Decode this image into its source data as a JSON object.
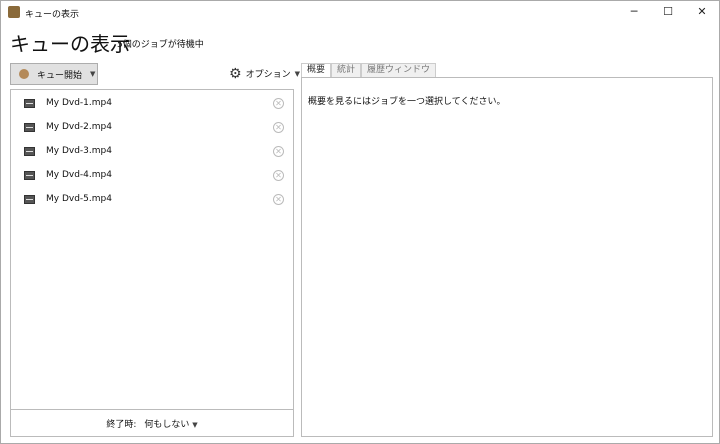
{
  "window": {
    "title": "キューの表示",
    "controls": [
      "─",
      "☐",
      "✕"
    ]
  },
  "header": {
    "title": "キューの表示",
    "subtitle": "5個のジョブが待機中"
  },
  "toolbar": {
    "start_label": "キュー開始",
    "options_label": "オプション"
  },
  "queue": {
    "items": [
      {
        "name": "My Dvd-1.mp4"
      },
      {
        "name": "My Dvd-2.mp4"
      },
      {
        "name": "My Dvd-3.mp4"
      },
      {
        "name": "My Dvd-4.mp4"
      },
      {
        "name": "My Dvd-5.mp4"
      }
    ]
  },
  "footer": {
    "label": "終了時:",
    "value": "何もしない"
  },
  "tabs": [
    {
      "label": "概要"
    },
    {
      "label": "統計"
    },
    {
      "label": "履歴ウィンドウ"
    }
  ],
  "summary": {
    "message": "概要を見るにはジョブを一つ選択してください。"
  }
}
